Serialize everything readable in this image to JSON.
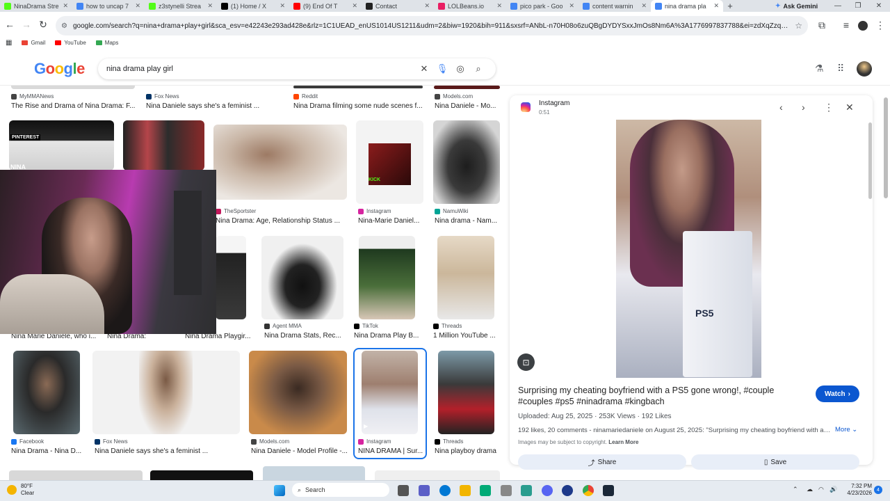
{
  "browser": {
    "tabs": [
      {
        "title": "NinaDrama Stre",
        "color": "#53fc18"
      },
      {
        "title": "how to uncap 7",
        "color": "#4285f4"
      },
      {
        "title": "z3stynelli Strea",
        "color": "#53fc18"
      },
      {
        "title": "(1) Home / X",
        "color": "#000000"
      },
      {
        "title": "(9) End Of T",
        "color": "#ff0000"
      },
      {
        "title": "Contact",
        "color": "#222222"
      },
      {
        "title": "LOLBeans.io",
        "color": "#e91e63"
      },
      {
        "title": "pico park - Goo",
        "color": "#4285f4"
      },
      {
        "title": "content warnin",
        "color": "#4285f4"
      },
      {
        "title": "nina drama pla",
        "color": "#4285f4"
      }
    ],
    "new_tab": "+",
    "ask_gemini": "Ask Gemini",
    "url": "google.com/search?q=nina+drama+play+girl&sca_esv=e42243e293ad428e&rlz=1C1UEAD_enUS1014US1211&udm=2&biw=1920&bih=911&sxsrf=ANbL-n70H08o6zuQBgDYDYSxxJmOs8Nm6A%3A1776997837788&ei=zdXqZzqL63CkPIPtP6XmAo...",
    "bookmarks": [
      {
        "label": "Gmail",
        "color": "#ea4335"
      },
      {
        "label": "YouTube",
        "color": "#ff0000"
      },
      {
        "label": "Maps",
        "color": "#34a853"
      }
    ]
  },
  "google": {
    "logo": "Google",
    "query": "nina drama play girl"
  },
  "results": [
    {
      "source": "MyMMANews",
      "title": "The Rise and Drama of Nina Drama: F...",
      "color": "#444"
    },
    {
      "source": "Fox News",
      "title": "Nina Daniele says she's a feminist ...",
      "color": "#003366"
    },
    {
      "source": "Reddit",
      "title": "Nina Drama filming some nude scenes f...",
      "color": "#ff4500"
    },
    {
      "source": "Models.com",
      "title": "Nina Daniele - Mo...",
      "color": "#444"
    },
    {
      "source": "TheSportster",
      "title": "Nina Drama: Age, Relationship Status ...",
      "color": "#c2185b"
    },
    {
      "source": "Instagram",
      "title": "Nina-Marie Daniel...",
      "color": "#d6249f"
    },
    {
      "source": "NamuWiki",
      "title": "Nina drama - Nam...",
      "color": "#00a495"
    },
    {
      "source": "",
      "title": "Nina Marie Daniele, who i...",
      "color": "#444"
    },
    {
      "source": "",
      "title": "Nina Drama:",
      "color": "#444"
    },
    {
      "source": "",
      "title": "Nina Drama Playgir...",
      "color": "#444"
    },
    {
      "source": "Agent MMA",
      "title": "Nina Drama Stats, Rec...",
      "color": "#333"
    },
    {
      "source": "TikTok",
      "title": "Nina Drama Play B...",
      "color": "#000"
    },
    {
      "source": "Threads",
      "title": "1 Million YouTube ...",
      "color": "#000"
    },
    {
      "source": "Facebook",
      "title": "Nina Drama - Nina D...",
      "color": "#1877f2"
    },
    {
      "source": "Fox News",
      "title": "Nina Daniele says she's a feminist ...",
      "color": "#003366"
    },
    {
      "source": "Models.com",
      "title": "Nina Daniele - Model Profile -...",
      "color": "#444"
    },
    {
      "source": "Instagram",
      "title": "NINA DRAMA | Sur...",
      "color": "#d6249f"
    },
    {
      "source": "Threads",
      "title": "Nina playboy drama",
      "color": "#000"
    }
  ],
  "thumb_text": {
    "pinterest": "PINTEREST",
    "nina": "NINA",
    "kick": "KICK"
  },
  "panel": {
    "source": "Instagram",
    "duration": "0:51",
    "video_label": "PS5",
    "title": "Surprising my cheating boyfriend with a PS5 gone wrong!, #couple #couples #ps5 #ninadrama #kingbach",
    "watch": "Watch",
    "uploaded": "Uploaded: Aug 25, 2025",
    "views": "253K Views",
    "likes": "192 Likes",
    "description": "192 likes, 20 comments - ninamariedaniele on August 25, 2025: \"Surprising my cheating boyfriend with a P...",
    "more": "More",
    "copyright": "Images may be subject to copyright.",
    "learn_more": "Learn More",
    "share": "Share",
    "save": "Save"
  },
  "taskbar": {
    "temp": "80°F",
    "condition": "Clear",
    "search": "Search",
    "time": "7:32 PM",
    "date": "4/23/2026",
    "notifications": "4"
  }
}
